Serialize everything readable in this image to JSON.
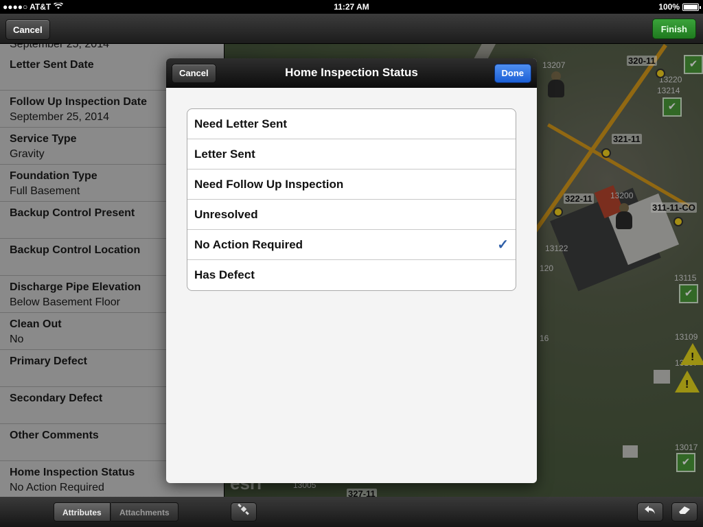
{
  "status_bar": {
    "carrier": "●●●●○ AT&T",
    "time": "11:27 AM",
    "battery": "100%"
  },
  "toolbar": {
    "cancel_label": "Cancel",
    "finish_label": "Finish"
  },
  "form": {
    "partial_top_value": "September 25, 2014",
    "fields": [
      {
        "label": "Letter Sent Date",
        "value": ""
      },
      {
        "label": "Follow Up Inspection Date",
        "value": "September 25, 2014"
      },
      {
        "label": "Service Type",
        "value": "Gravity"
      },
      {
        "label": "Foundation Type",
        "value": "Full Basement"
      },
      {
        "label": "Backup Control Present",
        "value": ""
      },
      {
        "label": "Backup Control Location",
        "value": ""
      },
      {
        "label": "Discharge Pipe Elevation",
        "value": "Below Basement Floor"
      },
      {
        "label": "Clean Out",
        "value": "No"
      },
      {
        "label": "Primary Defect",
        "value": ""
      },
      {
        "label": "Secondary Defect",
        "value": ""
      },
      {
        "label": "Other Comments",
        "value": ""
      },
      {
        "label": "Home Inspection Status",
        "value": "No Action Required"
      }
    ]
  },
  "bottom_tabs": {
    "attributes": "Attributes",
    "attachments": "Attachments"
  },
  "map": {
    "labels": [
      "320-11",
      "321-11",
      "322-11",
      "311-11-CO",
      "327-11"
    ],
    "numbers": [
      "13207",
      "13220",
      "13214",
      "13200",
      "13122",
      "120",
      "13115",
      "13109",
      "13107",
      "16",
      "13017",
      "13005"
    ],
    "watermark": "esri"
  },
  "modal": {
    "title": "Home Inspection Status",
    "cancel_label": "Cancel",
    "done_label": "Done",
    "options": [
      {
        "label": "Need Letter Sent",
        "checked": ""
      },
      {
        "label": "Letter Sent",
        "checked": ""
      },
      {
        "label": "Need Follow Up Inspection",
        "checked": ""
      },
      {
        "label": "Unresolved",
        "checked": ""
      },
      {
        "label": "No Action Required",
        "checked": "✓"
      },
      {
        "label": "Has Defect",
        "checked": ""
      }
    ]
  },
  "colors": {
    "finish_button": "#2a8f2a",
    "done_button": "#2f6fe0",
    "check_mark": "#2f5fa8"
  }
}
